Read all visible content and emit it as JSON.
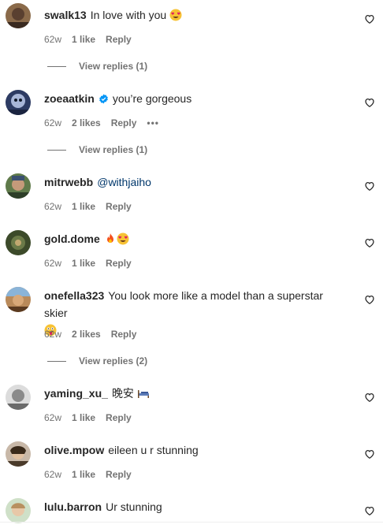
{
  "comments": [
    {
      "username": "swalk13",
      "text": "In love with you",
      "emoji": "heart-eyes",
      "time": "62w",
      "likes": "1 like",
      "reply": "Reply",
      "view_replies": "View replies (1)"
    },
    {
      "username": "zoeaatkin",
      "verified": true,
      "text": "you’re gorgeous",
      "time": "62w",
      "likes": "2 likes",
      "reply": "Reply",
      "more": "•••",
      "view_replies": "View replies (1)"
    },
    {
      "username": "mitrwebb",
      "mention": "@withjaiho",
      "time": "62w",
      "likes": "1 like",
      "reply": "Reply"
    },
    {
      "username": "gold.dome",
      "emoji": "fire heart-eyes",
      "time": "62w",
      "likes": "1 like",
      "reply": "Reply"
    },
    {
      "username": "onefella323",
      "text": "You look more like a model than a superstar skier",
      "emoji": "tongue",
      "time": "62w",
      "likes": "2 likes",
      "reply": "Reply",
      "view_replies": "View replies (2)"
    },
    {
      "username": "yaming_xu_",
      "text": "晚安",
      "emoji": "bed",
      "time": "62w",
      "likes": "1 like",
      "reply": "Reply"
    },
    {
      "username": "olive.mpow",
      "text": "eileen u r stunning",
      "time": "62w",
      "likes": "1 like",
      "reply": "Reply"
    },
    {
      "username": "lulu.barron",
      "text": "Ur stunning"
    }
  ],
  "colors": {
    "text": "#262626",
    "secondary": "#737373",
    "mention": "#00376b",
    "verified": "#0095f6"
  },
  "icons": {
    "like": "heart-outline-icon",
    "verified": "verified-badge-icon",
    "more": "more-options-icon"
  }
}
